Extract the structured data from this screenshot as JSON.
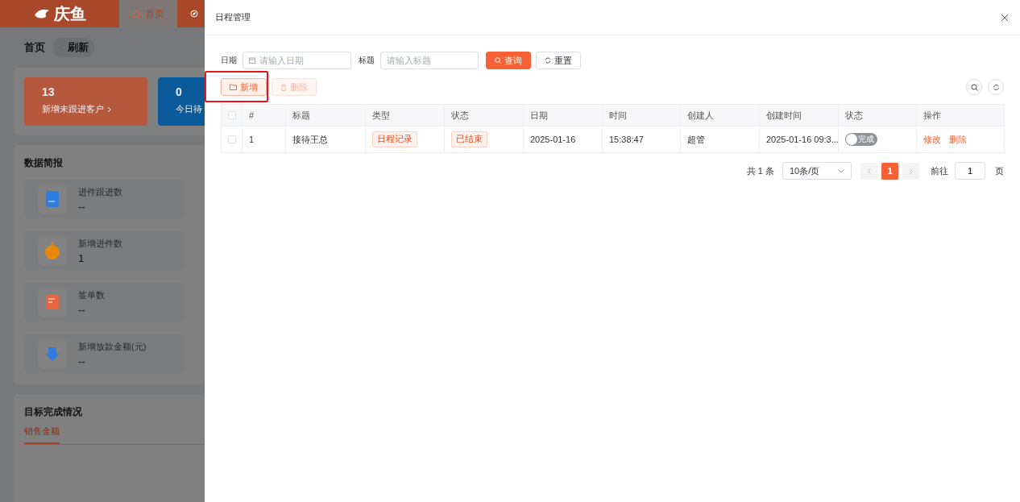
{
  "app": {
    "logo": "庆鱼",
    "nav": [
      {
        "label": "首页",
        "selected": true
      }
    ]
  },
  "page": {
    "title": "首页",
    "refresh": "刷新"
  },
  "stats": [
    {
      "value": "13",
      "label": "新增未跟进客户",
      "color": "#b5583e"
    },
    {
      "value": "0",
      "label": "今日待",
      "color": "#0b5a9c"
    }
  ],
  "briefing": {
    "title": "数据简报",
    "items": [
      {
        "kind": "doc",
        "label": "进件跟进数",
        "value": "--"
      },
      {
        "kind": "money",
        "label": "新增进件数",
        "value": "1"
      },
      {
        "kind": "sign",
        "label": "签单数",
        "value": "--"
      },
      {
        "kind": "loan",
        "label": "新增放款金额(元)",
        "value": "--"
      }
    ]
  },
  "goals": {
    "title": "目标完成情况",
    "tabs": [
      {
        "label": "销售金额",
        "selected": true
      }
    ]
  },
  "drawer": {
    "title": "日程管理",
    "filters": [
      {
        "label": "日期",
        "placeholder": "请输入日期",
        "kind": "date"
      },
      {
        "label": "标题",
        "placeholder": "请输入标题",
        "kind": "text"
      }
    ],
    "search_button": "查询",
    "reset_button": "重置",
    "toolbar": [
      {
        "label": "新增",
        "kind": "add",
        "disabled": false,
        "highlighted": true
      },
      {
        "label": "删除",
        "kind": "delete",
        "disabled": true,
        "highlighted": false
      }
    ],
    "table": {
      "header_checked": false,
      "columns": [
        "#",
        "标题",
        "类型",
        "状态",
        "日期",
        "时间",
        "创建人",
        "创建时间",
        "状态",
        "操作"
      ],
      "rows": [
        {
          "checked": false,
          "index": "1",
          "title": "接待王总",
          "type": "日程记录",
          "status": "已结束",
          "date": "2025-01-16",
          "time": "15:38:47",
          "creator": "超管",
          "created": "2025-01-16 09:3...",
          "switch": {
            "label": "完成",
            "on": false
          },
          "actions": [
            "修改",
            "删除"
          ]
        }
      ]
    },
    "pagination": {
      "total": "共 1 条",
      "page_size": "10条/页",
      "pages": [
        {
          "label": "1",
          "selected": true
        }
      ],
      "goto_label": "前往",
      "goto_value": "1",
      "page_suffix": "页"
    }
  }
}
